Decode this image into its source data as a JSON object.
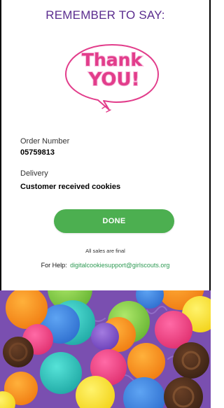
{
  "header": {
    "title": "REMEMBER TO SAY:"
  },
  "illustration": {
    "line1": "Thank",
    "line2": "YOU!"
  },
  "order": {
    "label": "Order Number",
    "value": "05759813"
  },
  "delivery": {
    "label": "Delivery",
    "value": "Customer received cookies"
  },
  "actions": {
    "done_label": "DONE"
  },
  "footer": {
    "final_note": "All sales are final",
    "help_label": "For Help:",
    "help_email": "digitalcookiesupport@girlscouts.org"
  },
  "colors": {
    "header_purple": "#5b2d8f",
    "thank_you_pink": "#e23d8b",
    "done_green": "#4caf50",
    "link_green": "#2e9a53",
    "background_purple": "#7a4fb0"
  },
  "icons": {
    "speech_bubble": "speech-bubble-icon",
    "cookie_pattern": "cookie-pattern-image"
  }
}
